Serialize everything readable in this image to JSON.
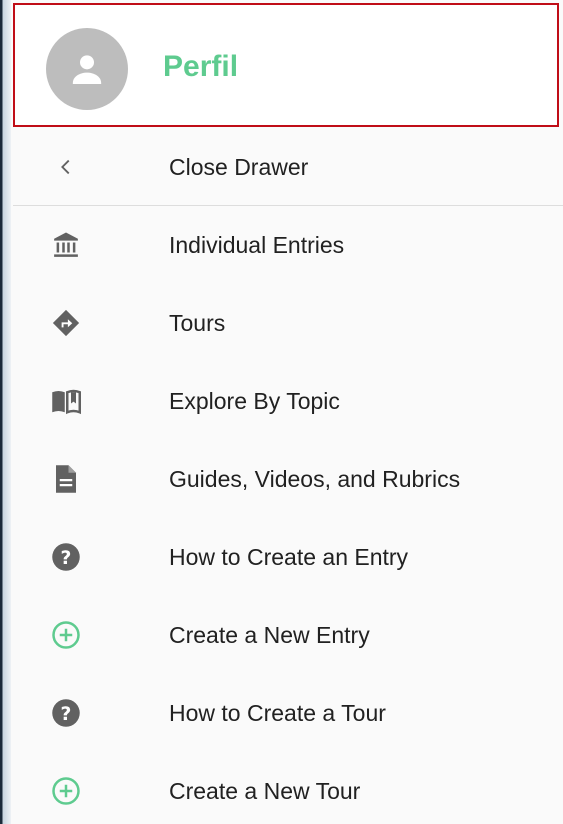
{
  "drawer": {
    "profile": {
      "name": "Perfil",
      "avatar_icon": "person-icon",
      "name_color": "#5ecb8f",
      "highlight_border_color": "#c00d17"
    },
    "items": [
      {
        "label": "Close Drawer",
        "icon": "chevron-left-icon"
      },
      {
        "label": "Individual Entries",
        "icon": "museum-icon"
      },
      {
        "label": "Tours",
        "icon": "directions-icon"
      },
      {
        "label": "Explore By Topic",
        "icon": "open-book-icon"
      },
      {
        "label": "Guides, Videos, and Rubrics",
        "icon": "document-icon"
      },
      {
        "label": "How to Create an Entry",
        "icon": "help-circle-icon"
      },
      {
        "label": "Create a New Entry",
        "icon": "add-circle-icon"
      },
      {
        "label": "How to Create a Tour",
        "icon": "help-circle-icon"
      },
      {
        "label": "Create a New Tour",
        "icon": "add-circle-icon"
      }
    ],
    "colors": {
      "icon_dark": "#616161",
      "icon_accent": "#5ecb8f"
    }
  }
}
